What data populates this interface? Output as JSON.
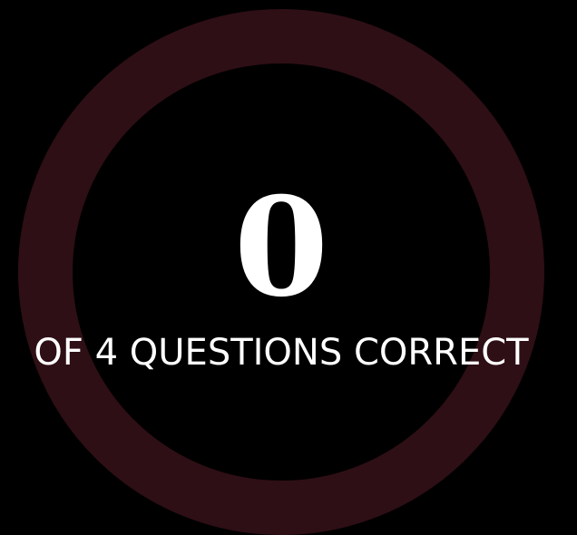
{
  "result": {
    "score": "0",
    "caption": "OF 4 QUESTIONS CORRECT",
    "correct_count": 0,
    "total_questions": 4
  },
  "colors": {
    "background": "#000000",
    "ring": "#2e0f15",
    "text": "#ffffff"
  }
}
